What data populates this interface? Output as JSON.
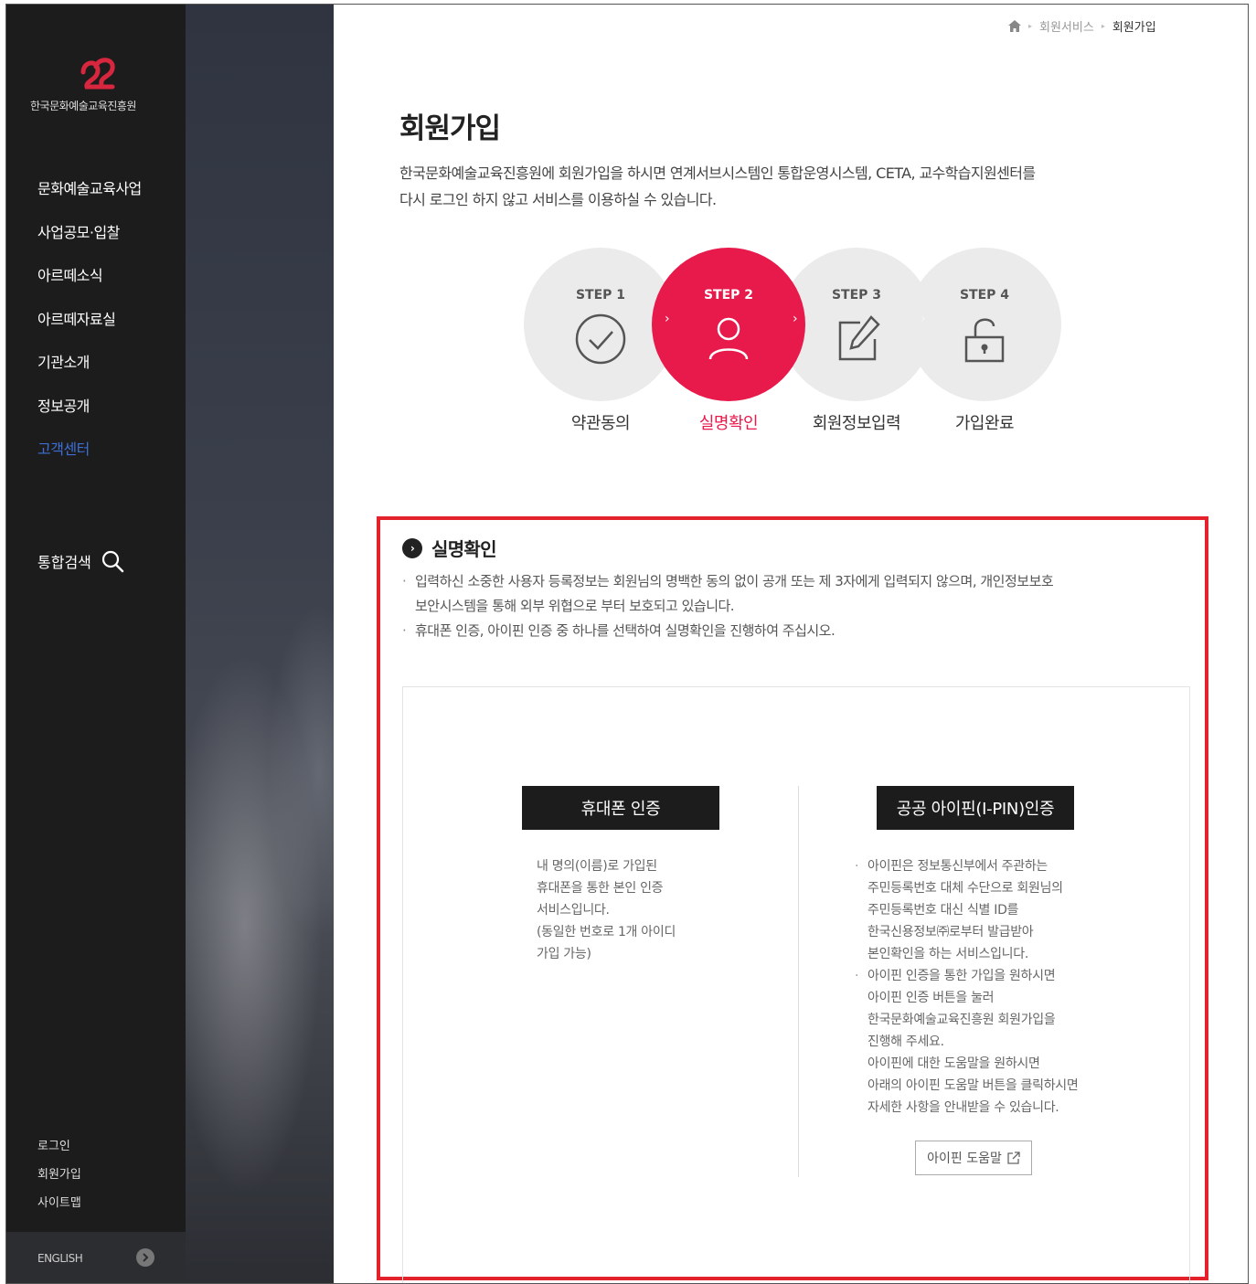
{
  "brand": {
    "logo_text": "한국문화예술교육진흥원",
    "accent_color": "#e8194b",
    "highlight_color": "#e3222c"
  },
  "sidebar": {
    "items": [
      {
        "label": "문화예술교육사업"
      },
      {
        "label": "사업공모·입찰"
      },
      {
        "label": "아르떼소식"
      },
      {
        "label": "아르떼자료실"
      },
      {
        "label": "기관소개"
      },
      {
        "label": "정보공개"
      },
      {
        "label": "고객센터",
        "active": true
      }
    ],
    "search_label": "통합검색",
    "bottom_links": [
      "로그인",
      "회원가입",
      "사이트맵"
    ],
    "language": "ENGLISH"
  },
  "breadcrumb": {
    "home_icon": "home-icon",
    "items": [
      "회원서비스",
      "회원가입"
    ]
  },
  "page": {
    "title": "회원가입",
    "intro_line1": "한국문화예술교육진흥원에 회원가입을 하시면 연계서브시스템인 통합운영시스템, CETA, 교수학습지원센터를",
    "intro_line2": "다시 로그인 하지 않고 서비스를 이용하실 수 있습니다."
  },
  "steps": [
    {
      "label": "STEP 1",
      "name": "약관동의",
      "icon": "check-icon"
    },
    {
      "label": "STEP 2",
      "name": "실명확인",
      "icon": "person-icon",
      "active": true
    },
    {
      "label": "STEP 3",
      "name": "회원정보입력",
      "icon": "edit-icon"
    },
    {
      "label": "STEP 4",
      "name": "가입완료",
      "icon": "unlock-icon"
    }
  ],
  "verification": {
    "title": "실명확인",
    "notes": [
      [
        "입력하신 소중한 사용자 등록정보는 회원님의 명백한 동의 없이 공개 또는 제 3자에게 입력되지 않으며, 개인정보보호",
        "보안시스템을 통해 외부 위협으로 부터 보호되고 있습니다."
      ],
      [
        "휴대폰 인증, 아이핀 인증 중 하나를 선택하여 실명확인을 진행하여 주십시오."
      ]
    ],
    "phone": {
      "button": "휴대폰 인증",
      "desc": [
        "내 명의(이름)로 가입된",
        "휴대폰을 통한 본인 인증",
        "서비스입니다.",
        "(동일한 번호로 1개 아이디",
        "가입 가능)"
      ]
    },
    "ipin": {
      "button": "공공 아이핀(I-PIN)인증",
      "bullet1": [
        "아이핀은 정보통신부에서 주관하는",
        "주민등록번호 대체 수단으로 회원님의",
        "주민등록번호 대신 식별 ID를",
        "한국신용정보㈜로부터 발급받아",
        "본인확인을 하는 서비스입니다."
      ],
      "bullet2": [
        "아이핀 인증을 통한 가입을 원하시면",
        "아이핀 인증 버튼을 눌러",
        "한국문화예술교육진흥원 회원가입을",
        "진행해 주세요."
      ],
      "extra": [
        "아이핀에 대한 도움말을 원하시면",
        "아래의 아이핀 도움말 버튼을 클릭하시면",
        "자세한 사항을 안내받을 수 있습니다."
      ],
      "help_button": "아이핀 도움말"
    }
  }
}
